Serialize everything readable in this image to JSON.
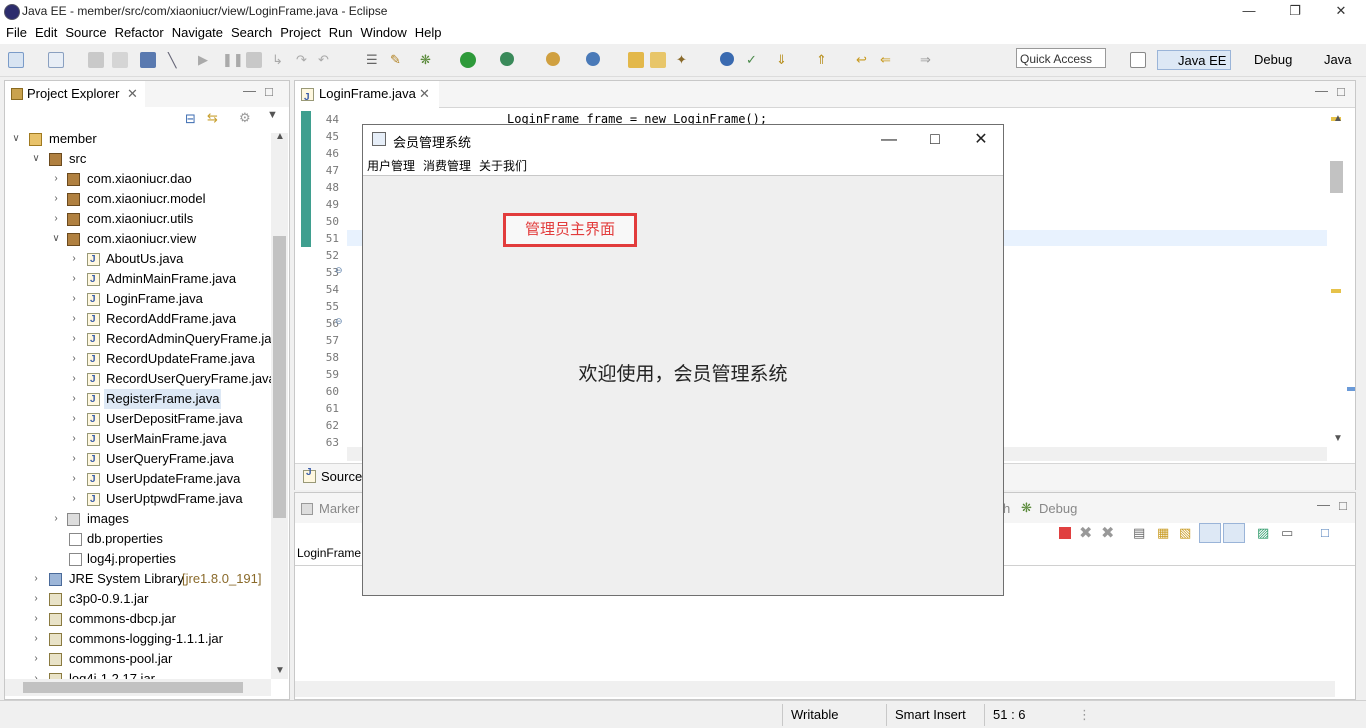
{
  "window": {
    "title": "Java EE - member/src/com/xiaoniucr/view/LoginFrame.java - Eclipse"
  },
  "menu": [
    "File",
    "Edit",
    "Source",
    "Refactor",
    "Navigate",
    "Search",
    "Project",
    "Run",
    "Window",
    "Help"
  ],
  "toolbar": {
    "quick_access": "Quick Access",
    "perspectives": [
      "Java EE",
      "Debug",
      "Java"
    ]
  },
  "explorer": {
    "tab_label": "Project Explorer",
    "tree": {
      "project": "member",
      "src": "src",
      "packages": [
        "com.xiaoniucr.dao",
        "com.xiaoniucr.model",
        "com.xiaoniucr.utils",
        "com.xiaoniucr.view"
      ],
      "files": [
        "AboutUs.java",
        "AdminMainFrame.java",
        "LoginFrame.java",
        "RecordAddFrame.java",
        "RecordAdminQueryFrame.ja",
        "RecordUpdateFrame.java",
        "RecordUserQueryFrame.java",
        "RegisterFrame.java",
        "UserDepositFrame.java",
        "UserMainFrame.java",
        "UserQueryFrame.java",
        "UserUpdateFrame.java",
        "UserUptpwdFrame.java"
      ],
      "images": "images",
      "db_properties": "db.properties",
      "log4j_properties": "log4j.properties",
      "jre": "JRE System Library",
      "jre_version": "[jre1.8.0_191]",
      "jars": [
        "c3p0-0.9.1.jar",
        "commons-dbcp.jar",
        "commons-logging-1.1.1.jar",
        "commons-pool.jar",
        "log4j-1.2.17.jar"
      ]
    }
  },
  "editor": {
    "tab_label": "LoginFrame.java",
    "line_numbers": [
      "44",
      "45",
      "46",
      "47",
      "48",
      "49",
      "50",
      "51",
      "52",
      "53",
      "54",
      "55",
      "56",
      "57",
      "58",
      "59",
      "60",
      "61",
      "62",
      "63"
    ],
    "code_line": "LoginFrame frame = new LoginFrame();",
    "bottom_tab": "Source"
  },
  "bottom": {
    "tab_markers": "Marker",
    "tab_debug": "Debug",
    "console_label": "LoginFrame"
  },
  "status": {
    "writable": "Writable",
    "insert_mode": "Smart Insert",
    "position": "51 : 6"
  },
  "swing": {
    "title": "会员管理系统",
    "menu": [
      "用户管理",
      "消费管理",
      "关于我们"
    ],
    "badge": "管理员主界面",
    "welcome": "欢迎使用，会员管理系统"
  }
}
